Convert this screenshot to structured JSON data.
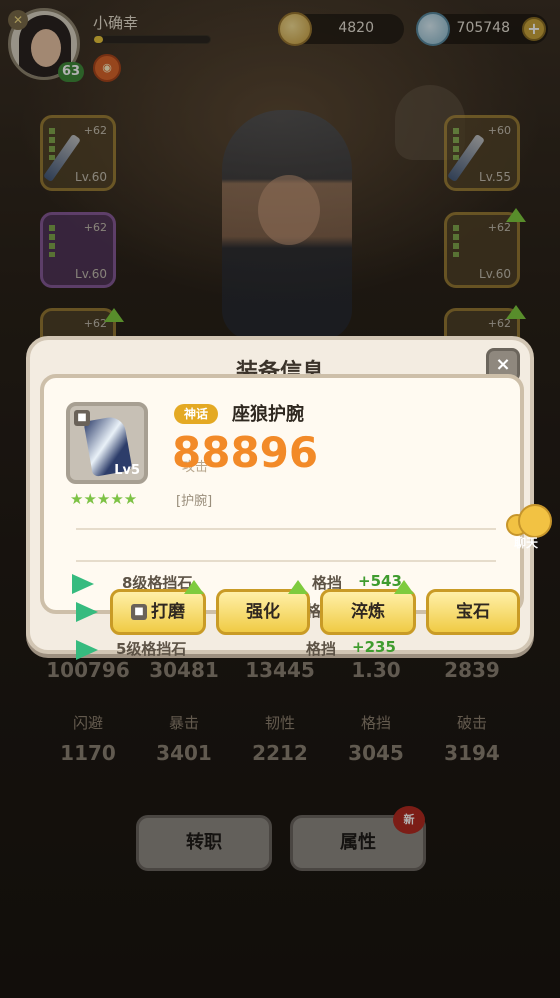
{
  "player": {
    "name": "小确幸",
    "level": "63",
    "exp_fraction": 0.08
  },
  "resources": {
    "gold": "4820",
    "diamond": "705748"
  },
  "slots": {
    "left_top": {
      "plus": "+62",
      "lv": "Lv.60"
    },
    "left_mid": {
      "plus": "+62",
      "lv": "Lv.60"
    },
    "left_bot": {
      "plus": "+62"
    },
    "right_top": {
      "plus": "+60",
      "lv": "Lv.55"
    },
    "right_mid": {
      "plus": "+62",
      "lv": "Lv.60"
    },
    "right_bot": {
      "plus": "+62"
    }
  },
  "modal": {
    "title": "装备信息",
    "close": "×",
    "item": {
      "rarity": "神话",
      "name": "座狼护腕",
      "power": "88896",
      "power_label": "攻击",
      "type": "[护腕]",
      "level": "Lv5",
      "stars": "★★★★★"
    },
    "gems": [
      {
        "name": "8级格挡石",
        "attr": "格挡",
        "bonus": "+543"
      },
      {
        "name": "",
        "attr": "格",
        "bonus": ""
      },
      {
        "name": "5级格挡石",
        "attr": "格挡",
        "bonus": "+235"
      }
    ],
    "buttons": {
      "grind": "打磨",
      "enhance": "强化",
      "temper": "淬炼",
      "gem": "宝石"
    }
  },
  "chat": {
    "label": "聊天"
  },
  "stats_top": {
    "values": [
      "100796",
      "30481",
      "13445",
      "1.30",
      "2839"
    ]
  },
  "stats_bottom": [
    {
      "label": "闪避",
      "value": "1170"
    },
    {
      "label": "暴击",
      "value": "3401"
    },
    {
      "label": "韧性",
      "value": "2212"
    },
    {
      "label": "格挡",
      "value": "3045"
    },
    {
      "label": "破击",
      "value": "3194"
    }
  ],
  "bottom_buttons": {
    "transfer": "转职",
    "attributes": "属性",
    "new_badge": "新"
  },
  "colors": {
    "power": "#f28a28",
    "rarity_tag": "#e4a923",
    "gem_bonus": "#3f9c2e",
    "button_yellow": "#f0cb45"
  }
}
